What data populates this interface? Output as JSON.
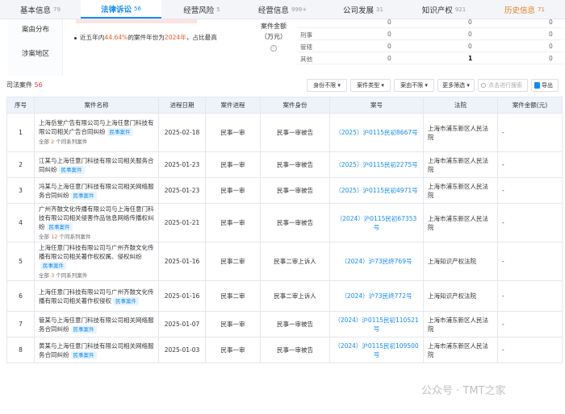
{
  "tabs": [
    {
      "label": "基本信息",
      "count": "79"
    },
    {
      "label": "法律诉讼",
      "count": "56"
    },
    {
      "label": "经营风险",
      "count": "5"
    },
    {
      "label": "经营信息",
      "count": "999+"
    },
    {
      "label": "公司发展",
      "count": "31"
    },
    {
      "label": "知识产权",
      "count": "921"
    },
    {
      "label": "历史信息",
      "count": "71"
    }
  ],
  "side_items": [
    "案由分布",
    "涉案地区"
  ],
  "summary": {
    "prefix": "近五年内",
    "percent": "44.64%",
    "mid": "的案件年份为",
    "year": "2024年",
    "suffix": "，占比最高"
  },
  "amount_label": "案件金额（万元）",
  "mini_rows": [
    {
      "label": "",
      "values": [
        "0",
        "0",
        "0"
      ]
    },
    {
      "label": "刑事",
      "values": [
        "0",
        "0",
        "0"
      ]
    },
    {
      "label": "管辖",
      "values": [
        "0",
        "0",
        "0"
      ]
    },
    {
      "label": "其他",
      "values": [
        "0",
        "1",
        "0"
      ]
    }
  ],
  "cases": {
    "label": "司法案件",
    "count": "56"
  },
  "filters": [
    "身份不限",
    "案件类型",
    "案由不限",
    "更多筛选"
  ],
  "search_placeholder": "点击进行搜索",
  "export_label": "导出",
  "columns": [
    "序号",
    "案件名称",
    "进程日期",
    "案件进程",
    "案件身份",
    "案号",
    "法院",
    "案件金额(元)"
  ],
  "tag_label": "民事案件",
  "rows": [
    {
      "no": "1",
      "name": "上海岳堂广告有限公司与上海任意门科技有限公司相关广告合同纠纷",
      "sub": {
        "pre": "全部",
        "n": "2",
        "post": "个同系列案件"
      },
      "date": "2025-02-18",
      "stage": "民事一审",
      "role": "民事一审被告",
      "case_no": "（2025）沪0115民初8667号",
      "court": "上海市浦东新区人民法院",
      "amount": "-"
    },
    {
      "no": "2",
      "name": "江某与上海任意门科技有限公司相关服务合同纠纷",
      "date": "2025-01-23",
      "stage": "民事一审",
      "role": "民事一审被告",
      "case_no": "（2025）沪0115民初2275号",
      "court": "上海市浦东新区人民法院",
      "amount": "-"
    },
    {
      "no": "3",
      "name": "冯某与上海任意门科技有限公司相关网络服务合同纠纷",
      "date": "2025-01-23",
      "stage": "民事一审",
      "role": "民事一审被告",
      "case_no": "（2025）沪0115民初4971号",
      "court": "上海市浦东新区人民法院",
      "amount": "-"
    },
    {
      "no": "4",
      "name": "广州齐鼓文化传播有限公司与上海任意门科技有限公司相关侵害作品信息网络传播权纠纷",
      "sub": {
        "pre": "全部",
        "n": "12",
        "post": "个同系列案件"
      },
      "date": "2025-01-21",
      "stage": "民事一审",
      "role": "民事一审被告",
      "case_no": "（2024）沪0115民初67353号",
      "court": "上海市浦东新区人民法院",
      "amount": "-"
    },
    {
      "no": "5",
      "name": "上海任意门科技有限公司与广州齐鼓文化传播有限公司相关著作权权属、侵权纠纷",
      "sub": {
        "pre": "全部",
        "n": "3",
        "post": "个同系列案件"
      },
      "date": "2025-01-16",
      "stage": "民事二审",
      "role": "民事二审上诉人",
      "case_no": "（2024）沪73民终769号",
      "court": "上海知识产权法院",
      "amount": "-"
    },
    {
      "no": "6",
      "name": "上海任意门科技有限公司与广州齐鼓文化传播有限公司相关著作权侵权",
      "date": "2025-01-16",
      "stage": "民事二审",
      "role": "民事二审上诉人",
      "case_no": "（2024）沪73民终772号",
      "court": "上海知识产权法院",
      "amount": "-"
    },
    {
      "no": "7",
      "name": "管某与上海任意门科技有限公司相关网络服务合同纠纷",
      "date": "2025-01-07",
      "stage": "民事一审",
      "role": "民事一审被告",
      "case_no": "（2024）沪0115民初110521号",
      "court": "上海市浦东新区人民法院",
      "amount": "-"
    },
    {
      "no": "8",
      "name": "黄某与上海任意门科技有限公司相关网络服务合同纠纷",
      "date": "2025-01-03",
      "stage": "民事一审",
      "role": "民事一审被告",
      "case_no": "（2024）沪0115民初109500号",
      "court": "上海市浦东新区人民法院",
      "amount": "-"
    }
  ],
  "watermark": "公众号 · TMT之家"
}
